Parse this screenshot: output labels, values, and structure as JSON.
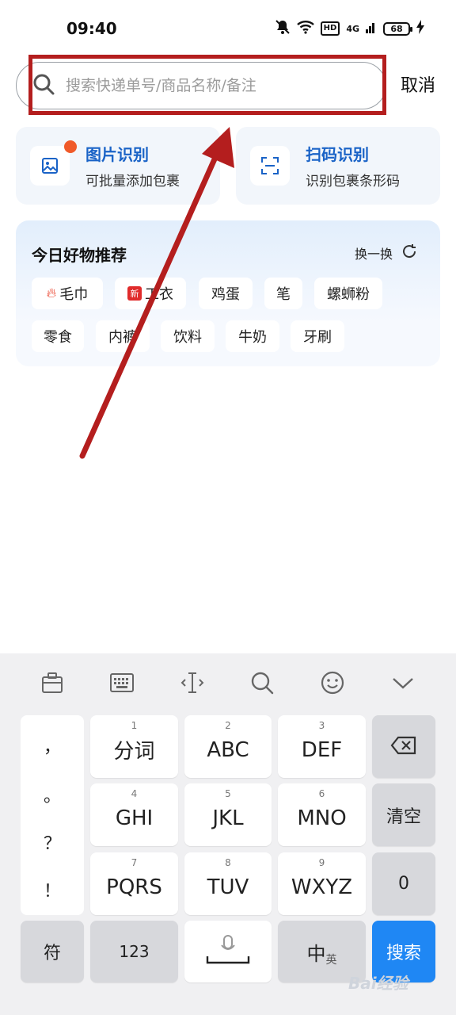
{
  "status_bar": {
    "time": "09:40",
    "hd": "HD",
    "network": "4G",
    "battery": "68"
  },
  "search": {
    "placeholder": "搜索快递单号/商品名称/备注",
    "value": "",
    "cancel_label": "取消"
  },
  "cards": [
    {
      "title": "图片识别",
      "subtitle": "可批量添加包裹",
      "icon": "image-icon",
      "has_badge": true
    },
    {
      "title": "扫码识别",
      "subtitle": "识别包裹条形码",
      "icon": "scan-icon",
      "has_badge": false
    }
  ],
  "recommend": {
    "title": "今日好物推荐",
    "refresh_label": "换一换",
    "chips": [
      {
        "label": "毛巾",
        "tag": "hot"
      },
      {
        "label": "工衣",
        "tag": "new",
        "tag_text": "新"
      },
      {
        "label": "鸡蛋"
      },
      {
        "label": "笔"
      },
      {
        "label": "螺蛳粉"
      },
      {
        "label": "零食"
      },
      {
        "label": "内裤"
      },
      {
        "label": "饮料"
      },
      {
        "label": "牛奶"
      },
      {
        "label": "牙刷"
      }
    ]
  },
  "keyboard": {
    "toolbar": [
      "clipboard-icon",
      "keyboard-icon",
      "cursor-icon",
      "search-icon",
      "emoji-icon",
      "collapse-icon"
    ],
    "punctuation": [
      "，",
      "。",
      "？",
      "！"
    ],
    "keys": [
      {
        "num": "1",
        "label": "分词"
      },
      {
        "num": "2",
        "label": "ABC"
      },
      {
        "num": "3",
        "label": "DEF"
      },
      {
        "num": "4",
        "label": "GHI"
      },
      {
        "num": "5",
        "label": "JKL"
      },
      {
        "num": "6",
        "label": "MNO"
      },
      {
        "num": "7",
        "label": "PQRS"
      },
      {
        "num": "8",
        "label": "TUV"
      },
      {
        "num": "9",
        "label": "WXYZ"
      }
    ],
    "clear_label": "清空",
    "zero_label": "0",
    "symbol_label": "符",
    "numeric_label": "123",
    "lang_main": "中",
    "lang_sub": "英",
    "search_label": "搜索"
  },
  "watermark": "Bai经验",
  "colors": {
    "accent": "#1a63c7",
    "annotation": "#b41e1e",
    "search_key": "#1f87f4"
  }
}
